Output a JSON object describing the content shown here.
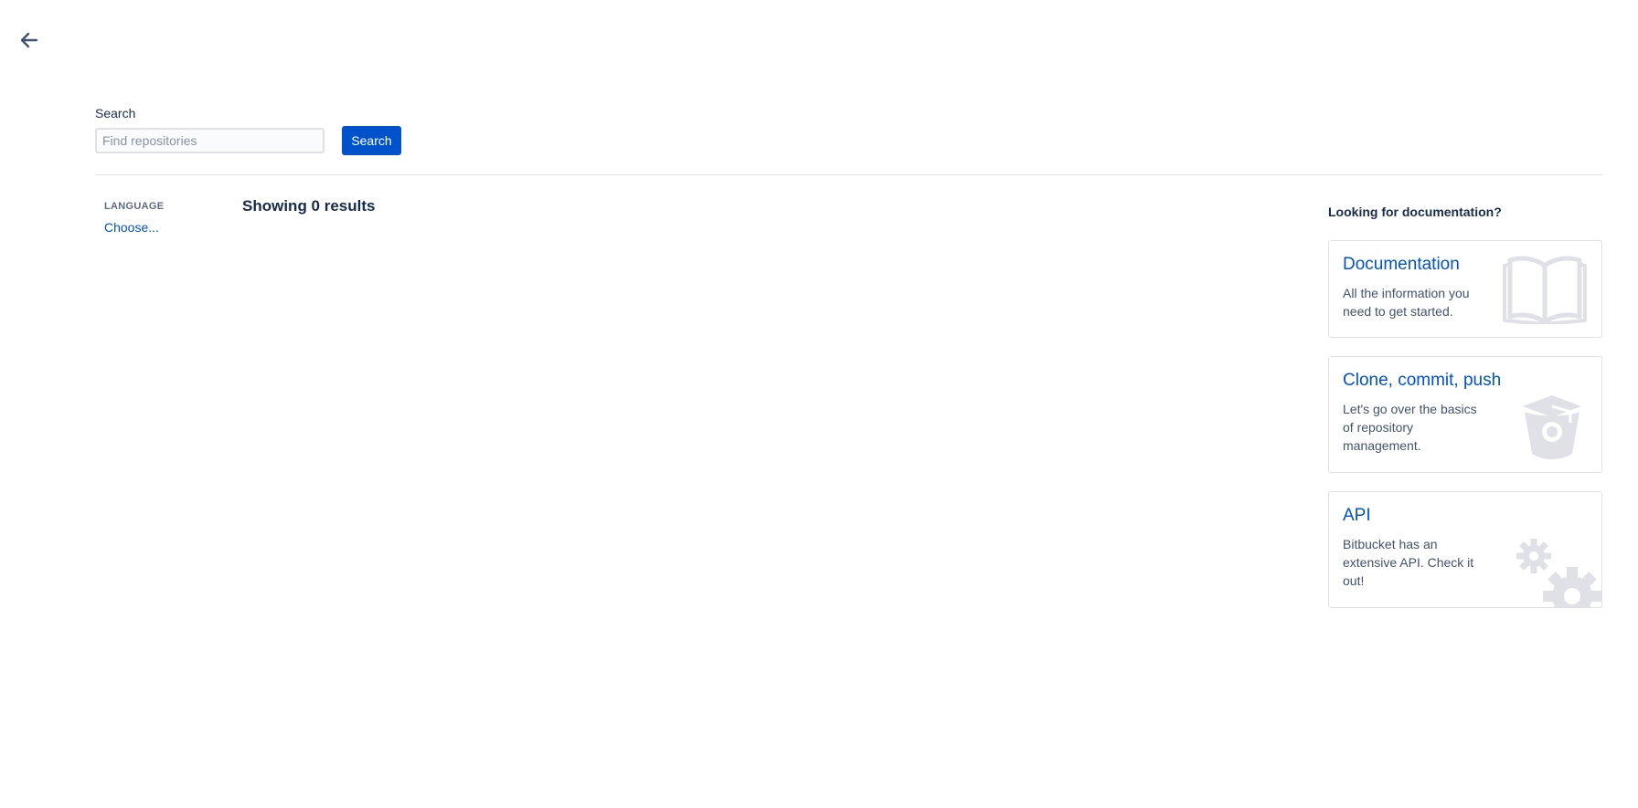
{
  "nav": {
    "back_icon": "arrow-left-icon"
  },
  "search": {
    "label": "Search",
    "placeholder": "Find repositories",
    "value": "",
    "button_label": "Search"
  },
  "filters": {
    "language": {
      "heading": "LANGUAGE",
      "link": "Choose..."
    }
  },
  "results": {
    "summary": "Showing 0 results"
  },
  "docs": {
    "heading": "Looking for documentation?",
    "cards": [
      {
        "title": "Documentation",
        "description": "All the information you need to get started.",
        "icon": "open-book-icon"
      },
      {
        "title": "Clone, commit, push",
        "description": "Let's go over the basics of repository management.",
        "icon": "bucket-icon"
      },
      {
        "title": "API",
        "description": "Bitbucket has an extensive API. Check it out!",
        "icon": "gears-icon"
      }
    ]
  },
  "colors": {
    "primary": "#0052cc",
    "text": "#172b4d",
    "muted": "#5e6c84",
    "border": "#dfe1e6",
    "icon_gray": "#dfe1e6"
  }
}
